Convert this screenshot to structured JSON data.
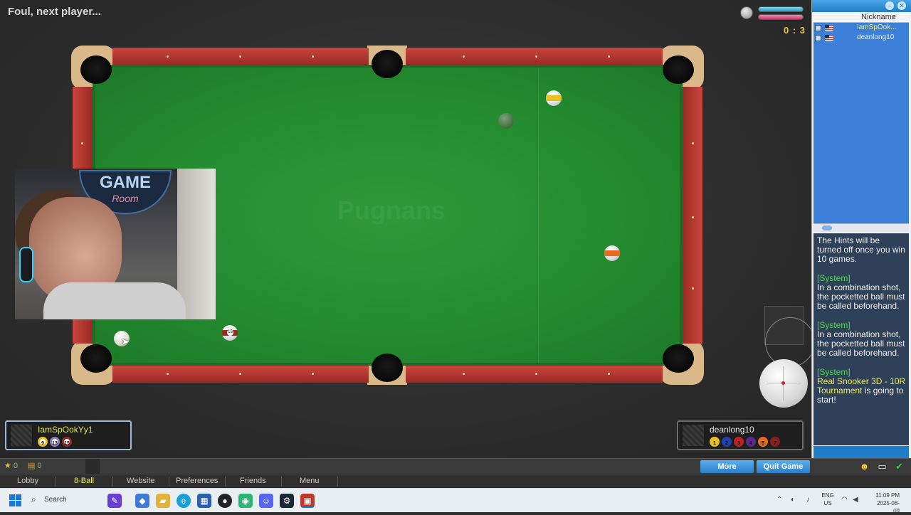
{
  "game": {
    "status_text": "Foul, next player...",
    "score": "0 : 3",
    "watermark": "Pugnans"
  },
  "webcam": {
    "sign_line1": "GAME",
    "sign_line2": "Room"
  },
  "players": {
    "p1": {
      "name": "IamSpOokYy1",
      "balls": [
        "9",
        "13",
        "15"
      ]
    },
    "p2": {
      "name": "deanlong10",
      "balls": [
        "1",
        "2",
        "3",
        "4",
        "5",
        "7"
      ]
    }
  },
  "balls_on_table": [
    {
      "type": "white",
      "label": "cue ball"
    },
    {
      "type": "green",
      "label": ""
    },
    {
      "type": "striped",
      "label": "9",
      "color": "#e8c020"
    },
    {
      "type": "striped",
      "label": "15",
      "color": "#9a2a24"
    },
    {
      "type": "striped",
      "label": "13",
      "color": "#e86a20"
    }
  ],
  "sidebar": {
    "header": "Nickname",
    "players": [
      "IamSpOok...",
      "deanlong10"
    ],
    "chat": [
      {
        "system": "",
        "text": "The Hints will be turned off once you win 10 games."
      },
      {
        "system": "[System]",
        "text": "In a combination shot, the pocketted ball must be called beforehand."
      },
      {
        "system": "[System]",
        "text": "In a combination shot, the pocketted ball must be called beforehand."
      },
      {
        "system": "[System]",
        "highlight": "Real Snooker 3D - 10R Tournament",
        "text_after": " is going to start!"
      }
    ]
  },
  "bottom_bar": {
    "stars": "0",
    "coins": "0",
    "more_label": "More",
    "quit_label": "Quit Game"
  },
  "nav": [
    "Lobby",
    "8-Ball",
    "Website",
    "Preferences",
    "Friends",
    "Menu"
  ],
  "taskbar": {
    "search_label": "Search",
    "lang_line1": "ENG",
    "lang_line2": "US",
    "time": "11:09 PM",
    "date": "2025-08-09"
  },
  "colors": {
    "felt": "#238a2f",
    "rail": "#b8362f",
    "accent_blue": "#2a7fcc",
    "system_green": "#4fd84f",
    "highlight_yellow": "#f3ef56"
  }
}
